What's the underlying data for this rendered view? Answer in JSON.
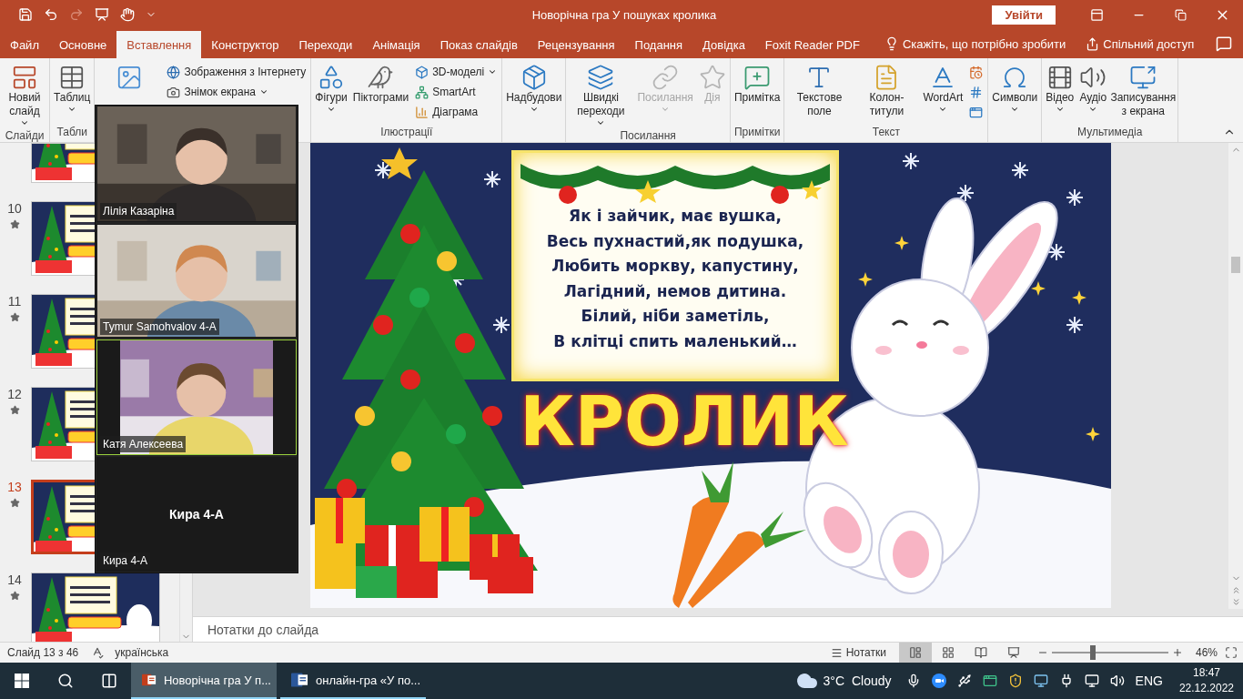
{
  "window": {
    "title": "Новорічна гра У пошуках кролика",
    "sign_in": "Увійти"
  },
  "tabs": [
    {
      "label": "Файл",
      "selected": false
    },
    {
      "label": "Основне",
      "selected": false
    },
    {
      "label": "Вставлення",
      "selected": true
    },
    {
      "label": "Конструктор",
      "selected": false
    },
    {
      "label": "Переходи",
      "selected": false
    },
    {
      "label": "Анімація",
      "selected": false
    },
    {
      "label": "Показ слайдів",
      "selected": false
    },
    {
      "label": "Рецензування",
      "selected": false
    },
    {
      "label": "Подання",
      "selected": false
    },
    {
      "label": "Довідка",
      "selected": false
    },
    {
      "label": "Foxit Reader PDF",
      "selected": false
    }
  ],
  "tell_me": "Скажіть, що потрібно зробити",
  "share": "Спільний доступ",
  "ribbon": {
    "groups": [
      {
        "label": "Слайди",
        "items": [
          {
            "kind": "large",
            "label": "Новий слайд",
            "dropdown": true,
            "disabled": false
          }
        ]
      },
      {
        "label": "Табли",
        "items": [
          {
            "kind": "large",
            "label": "Таблиц",
            "dropdown": true,
            "disabled": false
          }
        ]
      },
      {
        "items": [
          {
            "kind": "large",
            "dropdown": false,
            "disabled": false
          },
          {
            "kind": "small",
            "label": "Зображення з Інтернету",
            "dropdown": false,
            "disabled": false
          },
          {
            "kind": "small",
            "label": "Знімок екрана",
            "dropdown": true,
            "disabled": false
          }
        ]
      },
      {
        "label": "Ілюстрації",
        "items": [
          {
            "kind": "large",
            "label": "Фігури",
            "dropdown": true,
            "disabled": false
          },
          {
            "kind": "large",
            "label": "Піктограми",
            "dropdown": false,
            "disabled": false
          },
          {
            "kind": "small",
            "label": "3D-моделі",
            "dropdown": true,
            "disabled": false
          },
          {
            "kind": "small",
            "label": "SmartArt",
            "dropdown": false,
            "disabled": false
          },
          {
            "kind": "small",
            "label": "Діаграма",
            "dropdown": false,
            "disabled": false
          }
        ]
      },
      {
        "items": [
          {
            "kind": "large",
            "label": "Надбудови",
            "dropdown": true,
            "disabled": false
          }
        ]
      },
      {
        "label": "Посилання",
        "items": [
          {
            "kind": "large",
            "label": "Швидкі переходи",
            "dropdown": true,
            "disabled": false
          },
          {
            "kind": "large",
            "label": "Посилання",
            "dropdown": true,
            "disabled": true
          },
          {
            "kind": "large",
            "label": "Дія",
            "dropdown": false,
            "disabled": true
          }
        ]
      },
      {
        "label": "Примітки",
        "items": [
          {
            "kind": "large",
            "label": "Примітка",
            "dropdown": false,
            "disabled": false
          }
        ]
      },
      {
        "label": "Текст",
        "items": [
          {
            "kind": "large",
            "label": "Текстове поле",
            "dropdown": false,
            "disabled": false
          },
          {
            "kind": "large",
            "label": "Колон-титули",
            "dropdown": false,
            "disabled": false
          },
          {
            "kind": "large",
            "label": "WordArt",
            "dropdown": true,
            "disabled": false
          },
          {
            "kind": "icon",
            "dropdown": false,
            "disabled": false
          },
          {
            "kind": "icon",
            "dropdown": false,
            "disabled": false
          },
          {
            "kind": "icon",
            "dropdown": false,
            "disabled": false
          }
        ]
      },
      {
        "items": [
          {
            "kind": "large",
            "label": "Символи",
            "dropdown": true,
            "disabled": false
          }
        ]
      },
      {
        "label": "Мультимедіа",
        "items": [
          {
            "kind": "large",
            "label": "Відео",
            "dropdown": true,
            "disabled": false
          },
          {
            "kind": "large",
            "label": "Аудіо",
            "dropdown": true,
            "disabled": false
          },
          {
            "kind": "large",
            "label": "Записування з екрана",
            "dropdown": false,
            "disabled": false
          }
        ]
      }
    ]
  },
  "slides": [
    {
      "number": "10",
      "animated": true,
      "selected": false
    },
    {
      "number": "11",
      "animated": true,
      "selected": false
    },
    {
      "number": "12",
      "animated": true,
      "selected": false
    },
    {
      "number": "13",
      "animated": true,
      "selected": true
    },
    {
      "number": "14",
      "animated": true,
      "selected": false
    }
  ],
  "slide": {
    "poem": [
      "Як і зайчик, має вушка,",
      "Весь пухнастий,як подушка,",
      "Любить моркву, капустину,",
      "Лагідний, немов дитина.",
      "Білий, ніби заметіль,",
      "В клітці спить маленький…"
    ],
    "title": "КРОЛИК"
  },
  "notes_placeholder": "Нотатки до слайда",
  "video_call": {
    "tiles": [
      {
        "kind": "video",
        "name": "Лілія Казаріна",
        "selected": false
      },
      {
        "kind": "video",
        "name": "Tymur Samohvalov 4-A",
        "selected": false
      },
      {
        "kind": "portrait",
        "name": "Катя Алексеева",
        "selected": true
      },
      {
        "kind": "avatar",
        "title": "Кира 4-А",
        "name": "Кира 4-А",
        "selected": false
      }
    ]
  },
  "status_bar": {
    "slide": "Слайд 13 з 46",
    "language": "українська",
    "notes": "Нотатки",
    "views": [
      {
        "selected": true
      },
      {
        "selected": false
      },
      {
        "selected": false
      },
      {
        "selected": false
      }
    ],
    "zoom": {
      "level": 0.35,
      "reading": "46%"
    }
  },
  "taskbar": {
    "apps": [
      {
        "label": "Новорічна гра У п...",
        "selected": true
      },
      {
        "label": "онлайн-гра «У по...",
        "selected": false
      }
    ],
    "weather": {
      "temp": "3°C",
      "text": "Cloudy"
    },
    "language": "ENG",
    "time": "18:47",
    "date": "22.12.2022"
  }
}
